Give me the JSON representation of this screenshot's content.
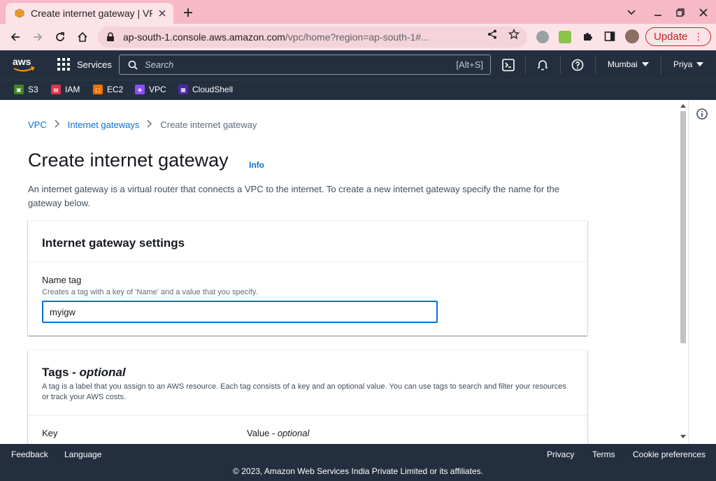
{
  "browser": {
    "tab_title": "Create internet gateway | VPC",
    "url_main": "ap-south-1.console.aws.amazon.com",
    "url_rest": "/vpc/home?region=ap-south-1#...",
    "update_label": "Update"
  },
  "aws_nav": {
    "services_label": "Services",
    "search_placeholder": "Search",
    "search_shortcut": "[Alt+S]",
    "region": "Mumbai",
    "user": "Priya"
  },
  "favorites": [
    {
      "label": "S3",
      "color": "#3f8624"
    },
    {
      "label": "IAM",
      "color": "#dd344c"
    },
    {
      "label": "EC2",
      "color": "#ed7100"
    },
    {
      "label": "VPC",
      "color": "#8c4fff"
    },
    {
      "label": "CloudShell",
      "color": "#4d27aa"
    }
  ],
  "breadcrumb": {
    "items": [
      "VPC",
      "Internet gateways"
    ],
    "current": "Create internet gateway"
  },
  "page": {
    "title": "Create internet gateway",
    "info_label": "Info",
    "description": "An internet gateway is a virtual router that connects a VPC to the internet. To create a new internet gateway specify the name for the gateway below."
  },
  "settings_card": {
    "header": "Internet gateway settings",
    "field_label": "Name tag",
    "field_description": "Creates a tag with a key of 'Name' and a value that you specify.",
    "field_value": "myigw"
  },
  "tags_card": {
    "header_main": "Tags - ",
    "header_italic": "optional",
    "description": "A tag is a label that you assign to an AWS resource. Each tag consists of a key and an optional value. You can use tags to search and filter your resources or track your AWS costs.",
    "col_key": "Key",
    "col_value_main": "Value - ",
    "col_value_italic": "optional"
  },
  "footer": {
    "feedback": "Feedback",
    "language": "Language",
    "privacy": "Privacy",
    "terms": "Terms",
    "cookies": "Cookie preferences",
    "copyright": "© 2023, Amazon Web Services India Private Limited or its affiliates."
  },
  "colors": {
    "aws_nav": "#232f3e",
    "link": "#0972d3",
    "chrome_frame": "#f6b9c5"
  }
}
